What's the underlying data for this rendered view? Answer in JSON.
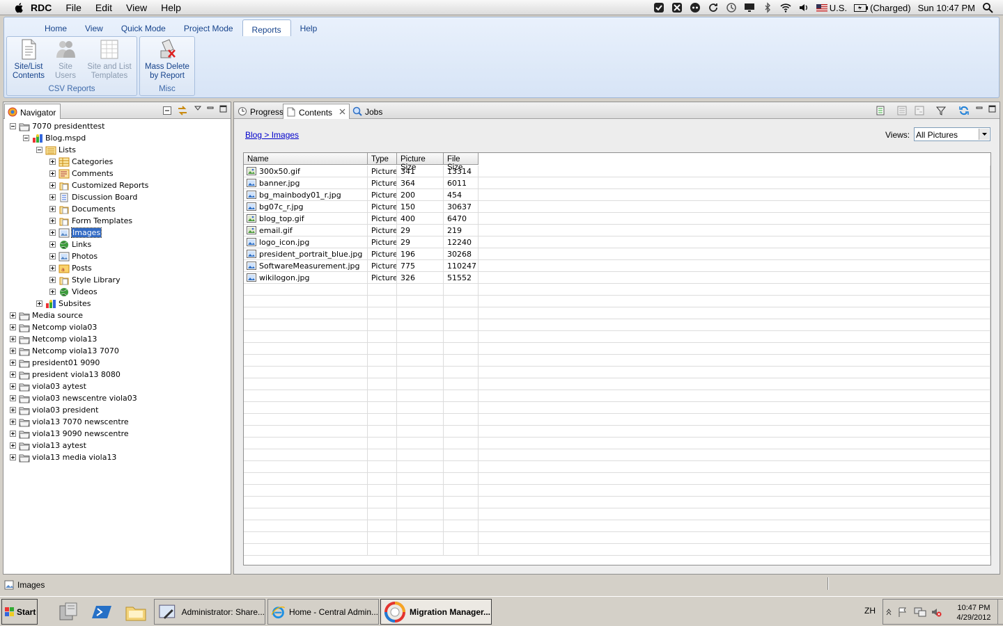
{
  "menubar": {
    "app_name": "RDC",
    "items": [
      "File",
      "Edit",
      "View",
      "Help"
    ],
    "input_source": "U.S.",
    "battery": "(Charged)",
    "clock": "Sun 10:47 PM"
  },
  "ribbon": {
    "tabs": [
      "Home",
      "View",
      "Quick Mode",
      "Project Mode",
      "Reports",
      "Help"
    ],
    "active_tab": "Reports",
    "groups": [
      {
        "label": "CSV Reports",
        "buttons": [
          {
            "line1": "Site/List",
            "line2": "Contents",
            "enabled": true
          },
          {
            "line1": "Site",
            "line2": "Users",
            "enabled": false
          },
          {
            "line1": "Site and List",
            "line2": "Templates",
            "enabled": false
          }
        ]
      },
      {
        "label": "Misc",
        "buttons": [
          {
            "line1": "Mass Delete",
            "line2": "by Report",
            "enabled": true
          }
        ]
      }
    ]
  },
  "navigator": {
    "title": "Navigator",
    "tree": [
      {
        "label": "7070 presidenttest",
        "level": 0,
        "expanded": true,
        "icon": "folder-icon"
      },
      {
        "label": "Blog.mspd",
        "level": 1,
        "expanded": true,
        "icon": "site-icon"
      },
      {
        "label": "Lists",
        "level": 2,
        "expanded": true,
        "icon": "lists-icon"
      },
      {
        "label": "Categories",
        "level": 3,
        "expanded": false,
        "icon": "list-icon"
      },
      {
        "label": "Comments",
        "level": 3,
        "expanded": false,
        "icon": "comments-icon"
      },
      {
        "label": "Customized Reports",
        "level": 3,
        "expanded": false,
        "icon": "doclib-icon"
      },
      {
        "label": "Discussion Board",
        "level": 3,
        "expanded": false,
        "icon": "discussion-icon"
      },
      {
        "label": "Documents",
        "level": 3,
        "expanded": false,
        "icon": "doclib-icon"
      },
      {
        "label": "Form Templates",
        "level": 3,
        "expanded": false,
        "icon": "doclib-icon"
      },
      {
        "label": "Images",
        "level": 3,
        "expanded": false,
        "icon": "picture-lib-icon",
        "selected": true
      },
      {
        "label": "Links",
        "level": 3,
        "expanded": false,
        "icon": "links-icon"
      },
      {
        "label": "Photos",
        "level": 3,
        "expanded": false,
        "icon": "picture-lib-icon"
      },
      {
        "label": "Posts",
        "level": 3,
        "expanded": false,
        "icon": "posts-icon"
      },
      {
        "label": "Style Library",
        "level": 3,
        "expanded": false,
        "icon": "doclib-icon"
      },
      {
        "label": "Videos",
        "level": 3,
        "expanded": false,
        "icon": "links-icon"
      },
      {
        "label": "Subsites",
        "level": 2,
        "expanded": false,
        "icon": "subsites-icon"
      },
      {
        "label": "Media source",
        "level": 0,
        "expanded": false,
        "icon": "folder-icon"
      },
      {
        "label": "Netcomp viola03",
        "level": 0,
        "expanded": false,
        "icon": "folder-icon"
      },
      {
        "label": "Netcomp viola13",
        "level": 0,
        "expanded": false,
        "icon": "folder-icon"
      },
      {
        "label": "Netcomp viola13 7070",
        "level": 0,
        "expanded": false,
        "icon": "folder-icon"
      },
      {
        "label": "president01 9090",
        "level": 0,
        "expanded": false,
        "icon": "folder-icon"
      },
      {
        "label": "president viola13 8080",
        "level": 0,
        "expanded": false,
        "icon": "folder-icon"
      },
      {
        "label": "viola03 aytest",
        "level": 0,
        "expanded": false,
        "icon": "folder-icon"
      },
      {
        "label": "viola03 newscentre viola03",
        "level": 0,
        "expanded": false,
        "icon": "folder-icon"
      },
      {
        "label": "viola03 president",
        "level": 0,
        "expanded": false,
        "icon": "folder-icon"
      },
      {
        "label": "viola13 7070 newscentre",
        "level": 0,
        "expanded": false,
        "icon": "folder-icon"
      },
      {
        "label": "viola13 9090 newscentre",
        "level": 0,
        "expanded": false,
        "icon": "folder-icon"
      },
      {
        "label": "viola13 aytest",
        "level": 0,
        "expanded": false,
        "icon": "folder-icon"
      },
      {
        "label": "viola13 media viola13",
        "level": 0,
        "expanded": false,
        "icon": "folder-icon"
      }
    ]
  },
  "content": {
    "tabs": [
      "Progress",
      "Contents",
      "Jobs"
    ],
    "active_tab": "Contents",
    "breadcrumb": "Blog > Images",
    "views_label": "Views:",
    "views_value": "All Pictures",
    "columns": [
      "Name",
      "Type",
      "Picture Size",
      "File Size"
    ],
    "rows": [
      {
        "name": "300x50.gif",
        "type": "Picture",
        "picture_size": "341",
        "file_size": "13314",
        "icon": "gif-icon"
      },
      {
        "name": "banner.jpg",
        "type": "Picture",
        "picture_size": "364",
        "file_size": "6011",
        "icon": "jpg-icon"
      },
      {
        "name": "bg_mainbody01_r.jpg",
        "type": "Picture",
        "picture_size": "200",
        "file_size": "454",
        "icon": "jpg-icon"
      },
      {
        "name": "bg07c_r.jpg",
        "type": "Picture",
        "picture_size": "150",
        "file_size": "30637",
        "icon": "jpg-icon"
      },
      {
        "name": "blog_top.gif",
        "type": "Picture",
        "picture_size": "400",
        "file_size": "6470",
        "icon": "gif-icon"
      },
      {
        "name": "email.gif",
        "type": "Picture",
        "picture_size": "29",
        "file_size": "219",
        "icon": "gif-icon"
      },
      {
        "name": "logo_icon.jpg",
        "type": "Picture",
        "picture_size": "29",
        "file_size": "12240",
        "icon": "jpg-icon"
      },
      {
        "name": "president_portrait_blue.jpg",
        "type": "Picture",
        "picture_size": "196",
        "file_size": "30268",
        "icon": "jpg-icon"
      },
      {
        "name": "SoftwareMeasurement.jpg",
        "type": "Picture",
        "picture_size": "775",
        "file_size": "110247",
        "icon": "jpg-icon"
      },
      {
        "name": "wikilogon.jpg",
        "type": "Picture",
        "picture_size": "326",
        "file_size": "51552",
        "icon": "jpg-icon"
      }
    ]
  },
  "statusbar": {
    "text": "Images"
  },
  "taskbar": {
    "start": "Start",
    "buttons": [
      {
        "label": "Administrator: Share...",
        "active": false
      },
      {
        "label": "Home - Central Admin...",
        "active": false
      },
      {
        "label": "Migration Manager...",
        "active": true
      }
    ],
    "lang": "ZH",
    "time": "10:47 PM",
    "date": "4/29/2012"
  }
}
